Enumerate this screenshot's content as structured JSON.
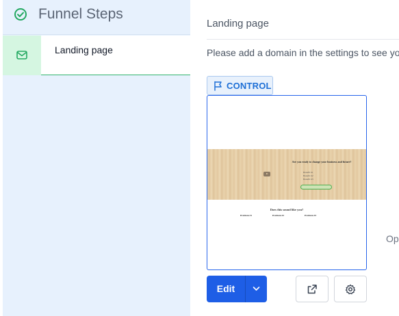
{
  "sidebar": {
    "title": "Funnel Steps",
    "title_icon": "check-circle-icon",
    "steps": [
      {
        "label": "Landing page",
        "icon": "mail-icon"
      }
    ]
  },
  "main": {
    "page_title": "Landing page",
    "notice": "Please add a domain in the settings to see you",
    "variant_badge": "CONTROL",
    "variant_icon": "flag-icon",
    "side_text": "Op",
    "edit_label": "Edit",
    "preview": {
      "hero_heading": "Are you ready to change your business and future?",
      "hero_bullets": [
        "Benefit #1",
        "Benefit #2",
        "Benefit #3"
      ],
      "section_title": "Does this sound like you?",
      "problems": [
        "Problem #1",
        "Problem #2",
        "Problem #3"
      ]
    }
  },
  "colors": {
    "accent": "#1e5ee6",
    "sidebar_bg": "#e7f1fd",
    "step_active_border": "#2fb36b",
    "check_green": "#22a860"
  }
}
